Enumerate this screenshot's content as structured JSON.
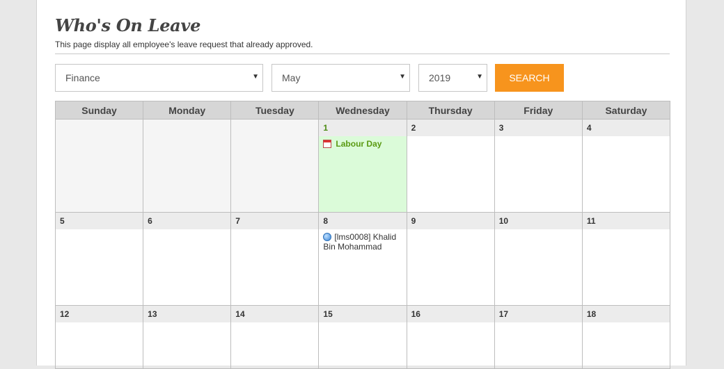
{
  "page": {
    "title": "Who's On Leave",
    "subtitle": "This page display all employee's leave request that already approved."
  },
  "filters": {
    "department": "Finance",
    "month": "May",
    "year": "2019",
    "search_label": "SEARCH"
  },
  "calendar": {
    "weekdays": [
      "Sunday",
      "Monday",
      "Tuesday",
      "Wednesday",
      "Thursday",
      "Friday",
      "Saturday"
    ],
    "weeks": [
      [
        "",
        "",
        "",
        "1",
        "2",
        "3",
        "4"
      ],
      [
        "5",
        "6",
        "7",
        "8",
        "9",
        "10",
        "11"
      ],
      [
        "12",
        "13",
        "14",
        "15",
        "16",
        "17",
        "18"
      ]
    ],
    "events": {
      "holiday": "Labour Day",
      "leave": "[lms0008] Khalid Bin Mohammad"
    }
  },
  "colors": {
    "accent": "#f7941d",
    "holiday_bg": "#dbfbd9",
    "holiday_text": "#5a9a12"
  },
  "icons": {
    "holiday": "calendar-icon",
    "leave": "blue-dot-icon",
    "dropdown": "caret-down-icon"
  }
}
